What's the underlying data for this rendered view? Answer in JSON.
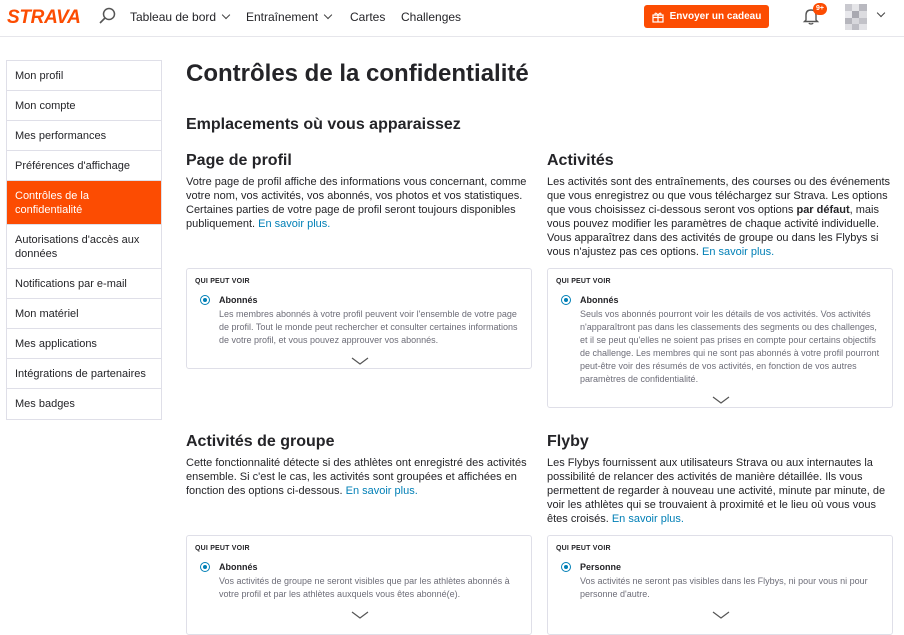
{
  "header": {
    "logo": "STRAVA",
    "nav": [
      {
        "label": "Tableau de bord",
        "has_dropdown": true
      },
      {
        "label": "Entraînement",
        "has_dropdown": true
      },
      {
        "label": "Cartes",
        "has_dropdown": false
      },
      {
        "label": "Challenges",
        "has_dropdown": false
      }
    ],
    "gift_button": "Envoyer un cadeau",
    "notification_count": "9+"
  },
  "sidebar": {
    "items": [
      {
        "label": "Mon profil",
        "active": false
      },
      {
        "label": "Mon compte",
        "active": false
      },
      {
        "label": "Mes performances",
        "active": false
      },
      {
        "label": "Préférences d'affichage",
        "active": false
      },
      {
        "label": "Contrôles de la confidentialité",
        "active": true
      },
      {
        "label": "Autorisations d'accès aux données",
        "active": false
      },
      {
        "label": "Notifications par e-mail",
        "active": false
      },
      {
        "label": "Mon matériel",
        "active": false
      },
      {
        "label": "Mes applications",
        "active": false
      },
      {
        "label": "Intégrations de partenaires",
        "active": false
      },
      {
        "label": "Mes badges",
        "active": false
      }
    ]
  },
  "main": {
    "title": "Contrôles de la confidentialité",
    "section_title": "Emplacements où vous apparaissez",
    "blocks": [
      {
        "heading": "Page de profil",
        "text": "Votre page de profil affiche des informations vous concernant, comme votre nom, vos activités, vos abonnés, vos photos et vos statistiques. Certaines parties de votre page de profil seront toujours disponibles publiquement.",
        "link": "En savoir plus.",
        "who_label": "QUI PEUT VOIR",
        "option_title": "Abonnés",
        "option_desc": "Les membres abonnés à votre profil peuvent voir l'ensemble de votre page de profil. Tout le monde peut rechercher et consulter certaines informations de votre profil, et vous pouvez approuver vos abonnés."
      },
      {
        "heading": "Activités",
        "text_before": "Les activités sont des entraînements, des courses ou des événements que vous enregistrez ou que vous téléchargez sur Strava. Les options que vous choisissez ci-dessous seront vos options",
        "text_bold": "par défaut",
        "text_after": ", mais vous pouvez modifier les paramètres de chaque activité individuelle. Vous apparaîtrez dans des activités de groupe ou dans les Flybys si vous n'ajustez pas ces options.",
        "link": "En savoir plus.",
        "who_label": "QUI PEUT VOIR",
        "option_title": "Abonnés",
        "option_desc": "Seuls vos abonnés pourront voir les détails de vos activités. Vos activités n'apparaîtront pas dans les classements des segments ou des challenges, et il se peut qu'elles ne soient pas prises en compte pour certains objectifs de challenge. Les membres qui ne sont pas abonnés à votre profil pourront peut-être voir des résumés de vos activités, en fonction de vos autres paramètres de confidentialité."
      },
      {
        "heading": "Activités de groupe",
        "text": "Cette fonctionnalité détecte si des athlètes ont enregistré des activités ensemble. Si c'est le cas, les activités sont groupées et affichées en fonction des options ci-dessous.",
        "link": "En savoir plus.",
        "who_label": "QUI PEUT VOIR",
        "option_title": "Abonnés",
        "option_desc": "Vos activités de groupe ne seront visibles que par les athlètes abonnés à votre profil et par les athlètes auxquels vous êtes abonné(e)."
      },
      {
        "heading": "Flyby",
        "text": "Les Flybys fournissent aux utilisateurs Strava ou aux internautes la possibilité de relancer des activités de manière détaillée. Ils vous permettent de regarder à nouveau une activité, minute par minute, de voir les athlètes qui se trouvaient à proximité et le lieu où vous vous êtes croisés.",
        "link": "En savoir plus.",
        "who_label": "QUI PEUT VOIR",
        "option_title": "Personne",
        "option_desc": "Vos activités ne seront pas visibles dans les Flybys, ni pour vous ni pour personne d'autre."
      }
    ]
  },
  "colors": {
    "brand": "#fc4c02",
    "link": "#007fb6",
    "border": "#dfdfe8"
  }
}
